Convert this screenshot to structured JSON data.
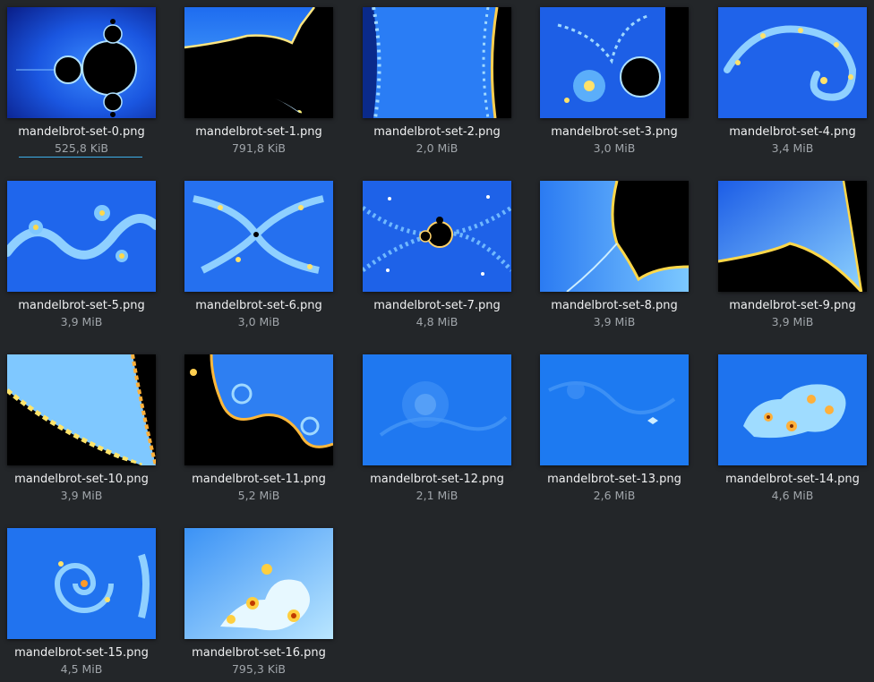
{
  "files": [
    {
      "name": "mandelbrot-set-0.png",
      "size": "525,8 KiB",
      "preview": "full-set"
    },
    {
      "name": "mandelbrot-set-1.png",
      "size": "791,8 KiB",
      "preview": "bulb-edge"
    },
    {
      "name": "mandelbrot-set-2.png",
      "size": "2,0 MiB",
      "preview": "seahorse-valley"
    },
    {
      "name": "mandelbrot-set-3.png",
      "size": "3,0 MiB",
      "preview": "spiral-bulb"
    },
    {
      "name": "mandelbrot-set-4.png",
      "size": "3,4 MiB",
      "preview": "spiral-arc"
    },
    {
      "name": "mandelbrot-set-5.png",
      "size": "3,9 MiB",
      "preview": "spiral-field"
    },
    {
      "name": "mandelbrot-set-6.png",
      "size": "3,0 MiB",
      "preview": "filaments"
    },
    {
      "name": "mandelbrot-set-7.png",
      "size": "4,8 MiB",
      "preview": "mini-brot"
    },
    {
      "name": "mandelbrot-set-8.png",
      "size": "3,9 MiB",
      "preview": "cardioid-edge"
    },
    {
      "name": "mandelbrot-set-9.png",
      "size": "3,9 MiB",
      "preview": "boundary-slope"
    },
    {
      "name": "mandelbrot-set-10.png",
      "size": "3,9 MiB",
      "preview": "diagonal-edge"
    },
    {
      "name": "mandelbrot-set-11.png",
      "size": "5,2 MiB",
      "preview": "spiral-edges"
    },
    {
      "name": "mandelbrot-set-12.png",
      "size": "2,1 MiB",
      "preview": "faint-spiral"
    },
    {
      "name": "mandelbrot-set-13.png",
      "size": "2,6 MiB",
      "preview": "faint-swirl"
    },
    {
      "name": "mandelbrot-set-14.png",
      "size": "4,6 MiB",
      "preview": "island"
    },
    {
      "name": "mandelbrot-set-15.png",
      "size": "4,5 MiB",
      "preview": "double-spiral"
    },
    {
      "name": "mandelbrot-set-16.png",
      "size": "795,3 KiB",
      "preview": "yellow-bulbs"
    }
  ],
  "focused_index": 0
}
